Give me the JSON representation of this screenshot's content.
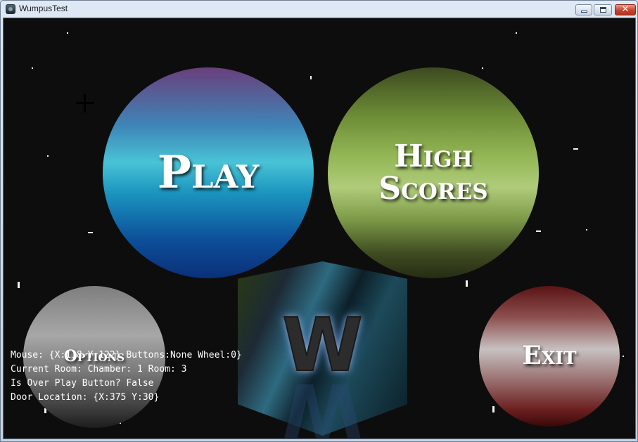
{
  "window": {
    "title": "WumpusTest",
    "close_glyph": "✕"
  },
  "menu": {
    "play": "Play",
    "high_scores": "High Scores",
    "options": "Options",
    "exit": "Exit"
  },
  "logo": {
    "letter": "W"
  },
  "debug": {
    "mouse": "Mouse: {X:118 Y:122} Buttons:None Wheel:0}",
    "current_room": "Current Room: Chamber: 1 Room: 3",
    "over_play": "Is Over Play Button? False",
    "door_location": "Door Location: {X:375 Y:30}"
  },
  "colors": {
    "background": "#0d0d0d",
    "play_orb": "#49c3d6",
    "scores_orb": "#93b655",
    "options_orb": "#a7a7a7",
    "exit_orb": "#c7c1c1"
  },
  "icons": {
    "app": "app-icon",
    "cursor": "crosshair-cursor-icon",
    "minimize": "minimize-icon",
    "maximize": "maximize-icon",
    "close": "close-icon"
  }
}
